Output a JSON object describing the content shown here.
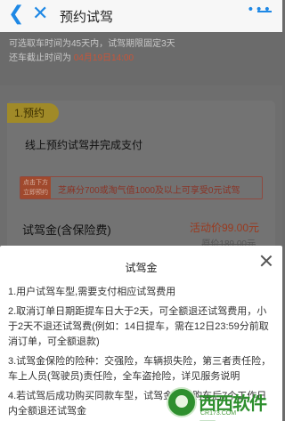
{
  "header": {
    "back_icon": "chevron-left",
    "close_icon": "close",
    "title": "预约试驾",
    "more_icon": "more",
    "more_label": "•••"
  },
  "info": {
    "line1": "可选取车时间为45天内，试驾期限固定3天",
    "line2_prefix": "还车截止时间为 ",
    "line2_date": "04月19日14:00"
  },
  "step": {
    "label": "1.预约",
    "text": "线上预约试驾并完成支付"
  },
  "promo": {
    "tag_line1": "点击下方",
    "tag_line2": "立即预约",
    "text": "芝麻分700或淘气值1000及以上可享受0元试驾"
  },
  "deposit": {
    "label": "试驾金(含保险费)",
    "price": "活动价99.00元",
    "original": "原价189.00元"
  },
  "sheet": {
    "title": "试驾金",
    "paragraphs": [
      "1.用户试驾车型,需要支付相应试驾费用",
      "2.取消订单日期距提车日大于2天，可全额退还试驾费用，小于2天不退还试驾费(例如：14日提车，需在12日23:59分前取消订单，可全额退款)",
      "3.试驾金保险的险种：交强险，车辆损失险，第三者责任险，车上人员(驾驶员)责任险，全车盗抢险，详见服务说明",
      "4.若试驾后成功购买同款车型，试驾金将在购车后7个工作日内全额退还试驾金"
    ]
  },
  "watermark": {
    "brand": "西西软件园",
    "sub": "CR173.COM"
  },
  "colors": {
    "accent": "#1e88e5",
    "price_red": "#d04a24",
    "step_yellow": "#f5d130"
  }
}
